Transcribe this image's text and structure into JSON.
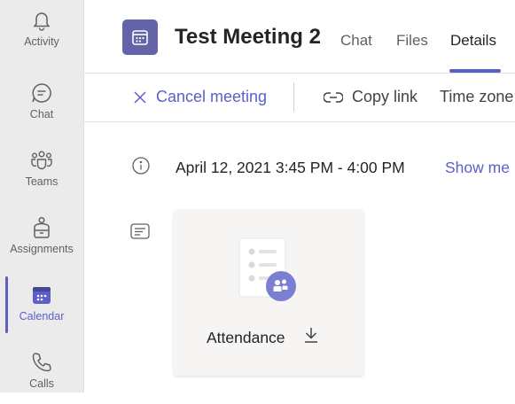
{
  "rail": {
    "items": [
      {
        "label": "Activity",
        "icon": "bell-icon"
      },
      {
        "label": "Chat",
        "icon": "chat-icon"
      },
      {
        "label": "Teams",
        "icon": "teams-icon"
      },
      {
        "label": "Assignments",
        "icon": "assignments-icon"
      },
      {
        "label": "Calendar",
        "icon": "calendar-icon",
        "active": true
      },
      {
        "label": "Calls",
        "icon": "phone-icon"
      }
    ]
  },
  "header": {
    "title": "Test Meeting 2",
    "tabs": [
      {
        "label": "Chat"
      },
      {
        "label": "Files"
      },
      {
        "label": "Details",
        "active": true
      }
    ]
  },
  "toolbar": {
    "cancel_label": "Cancel meeting",
    "copy_label": "Copy link",
    "timezone_label": "Time zone"
  },
  "details": {
    "datetime": "April 12, 2021 3:45 PM - 4:00 PM",
    "show_more": "Show me"
  },
  "attendance_card": {
    "label": "Attendance"
  },
  "colors": {
    "accent": "#5b5fc7",
    "meeting_icon_bg": "#6264a7",
    "rail_bg": "#ebebeb"
  }
}
